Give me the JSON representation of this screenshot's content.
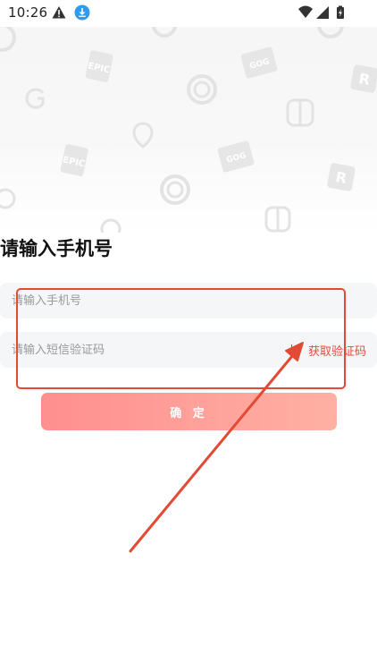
{
  "status_bar": {
    "time": "10:26",
    "left_icons": [
      "warning-icon",
      "download-icon"
    ],
    "right_icons": [
      "wifi-icon",
      "signal-icon",
      "battery-charging-icon"
    ]
  },
  "watermark": {
    "logos": [
      "g-logo-icon",
      "epic-games-logo-icon",
      "gog-com-logo-icon",
      "ubisoft-logo-icon",
      "nintendo-switch-logo-icon",
      "location-pin-icon",
      "rockstar-logo-icon"
    ]
  },
  "form": {
    "title": "请输入手机号",
    "phone_placeholder": "请输入手机号",
    "code_placeholder": "请输入短信验证码",
    "divider": "|",
    "get_code_label": "获取验证码",
    "confirm_label": "确 定"
  },
  "colors": {
    "accent": "#e54a3c",
    "annotation": "#e24a33",
    "button_start": "#ff8f8f",
    "button_end": "#ffb0a3",
    "input_bg": "#f5f6f8"
  }
}
